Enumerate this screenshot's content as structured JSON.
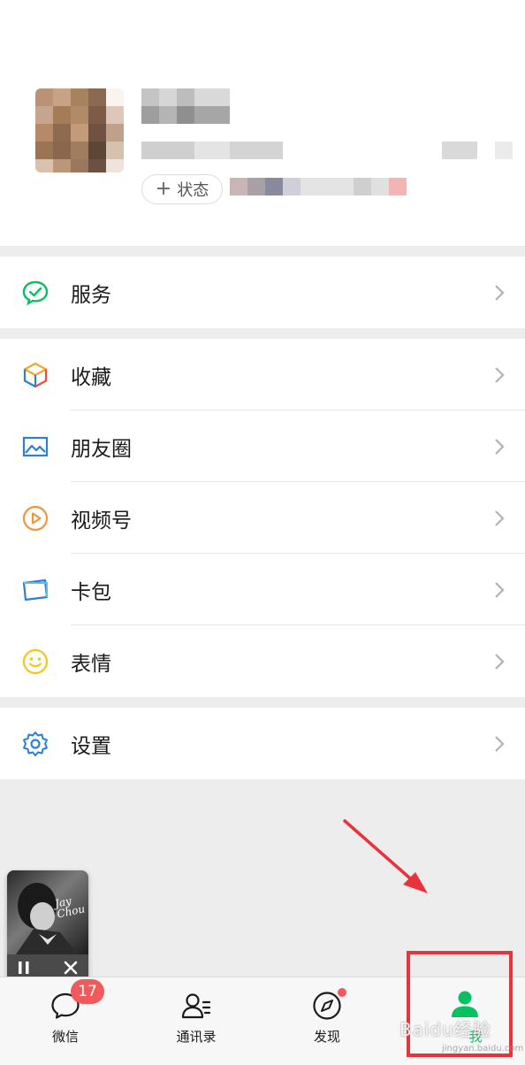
{
  "profile": {
    "status_label": "状态",
    "status_icon": "plus-icon"
  },
  "menu": {
    "group1": [
      {
        "label": "服务",
        "icon": "service-icon",
        "color": "#07c160"
      }
    ],
    "group2": [
      {
        "label": "收藏",
        "icon": "favorites-cube-icon",
        "color": "#f5a623"
      },
      {
        "label": "朋友圈",
        "icon": "moments-image-icon",
        "color": "#2d7fd1"
      },
      {
        "label": "视频号",
        "icon": "channels-play-icon",
        "color": "#f0973b"
      },
      {
        "label": "卡包",
        "icon": "card-wallet-icon",
        "color": "#2d7fd1"
      },
      {
        "label": "表情",
        "icon": "sticker-smile-icon",
        "color": "#f5c518"
      }
    ],
    "group3": [
      {
        "label": "设置",
        "icon": "settings-gear-icon",
        "color": "#2d7fd1"
      }
    ]
  },
  "player": {
    "cover_text": "Jay Chou",
    "pause_icon": "pause-icon",
    "close_icon": "close-icon"
  },
  "tabbar": {
    "tabs": [
      {
        "label": "微信",
        "icon": "chat-bubble-icon",
        "badge": "17"
      },
      {
        "label": "通讯录",
        "icon": "contacts-icon"
      },
      {
        "label": "发现",
        "icon": "compass-icon"
      },
      {
        "label": "我",
        "icon": "me-person-icon",
        "active": true
      }
    ],
    "active_color": "#07c160"
  },
  "watermark": {
    "brand": "Baidu经验",
    "url": "jingyan.baidu.com"
  }
}
